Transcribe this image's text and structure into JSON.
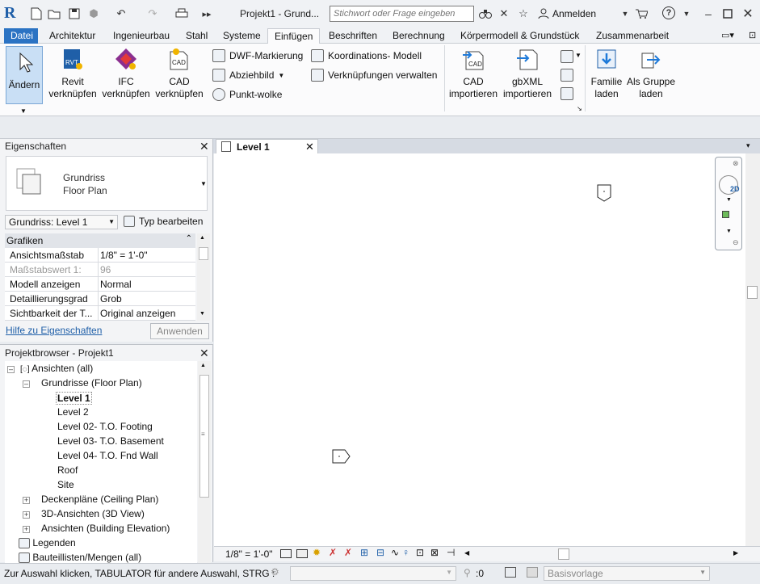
{
  "window": {
    "title": "Projekt1 - Grund...",
    "search_placeholder": "Stichwort oder Frage eingeben",
    "signin_label": "Anmelden",
    "help_label": "?"
  },
  "menu_tabs": {
    "file": "Datei",
    "architektur": "Architektur",
    "ingenieurbau": "Ingenieurbau",
    "stahl": "Stahl",
    "systeme": "Systeme",
    "einfuegen": "Einfügen",
    "beschriften": "Beschriften",
    "berechnung": "Berechnung",
    "koerpermodell": "Körpermodell & Grundstück",
    "zusammenarbeit": "Zusammenarbeit"
  },
  "ribbon": {
    "modify": "Ändern",
    "revit_link_1": "Revit",
    "revit_link_2": "verknüpfen",
    "ifc_link_1": "IFC",
    "ifc_link_2": "verknüpfen",
    "cad_link_1": "CAD",
    "cad_link_2": "verknüpfen",
    "dwf_markup": "DWF-Markierung",
    "decal": "Abziehbild",
    "point_cloud": "Punkt-wolke",
    "coord_model": "Koordinations- Modell",
    "manage_links": "Verknüpfungen verwalten",
    "cad_import_1": "CAD",
    "cad_import_2": "importieren",
    "gbxml_1": "gbXML",
    "gbxml_2": "importieren",
    "family_1": "Familie",
    "family_2": "laden",
    "group_1": "Als Gruppe",
    "group_2": "laden",
    "revit_icon_text": "RVT",
    "cad_icon_text": "CAD"
  },
  "properties": {
    "title": "Eigenschaften",
    "type_name_1": "Grundriss",
    "type_name_2": "Floor Plan",
    "instance_select": "Grundriss: Level 1",
    "edit_type": "Typ bearbeiten",
    "group_graphics": "Grafiken",
    "rows": [
      {
        "key": "Ansichtsmaßstab",
        "value": "1/8\" = 1'-0\""
      },
      {
        "key": "Maßstabswert 1:",
        "value": "96"
      },
      {
        "key": "Modell anzeigen",
        "value": "Normal"
      },
      {
        "key": "Detaillierungsgrad",
        "value": "Grob"
      },
      {
        "key": "Sichtbarkeit der T...",
        "value": "Original anzeigen"
      }
    ],
    "help_link": "Hilfe zu Eigenschaften",
    "apply_button": "Anwenden"
  },
  "project_browser": {
    "title": "Projektbrowser - Projekt1",
    "items": [
      {
        "label": "Ansichten (all)"
      },
      {
        "label": "Grundrisse (Floor Plan)"
      },
      {
        "label": "Level 1"
      },
      {
        "label": "Level 2"
      },
      {
        "label": "Level 02- T.O. Footing"
      },
      {
        "label": "Level 03- T.O. Basement"
      },
      {
        "label": "Level 04- T.O. Fnd Wall"
      },
      {
        "label": "Roof"
      },
      {
        "label": "Site"
      },
      {
        "label": "Deckenpläne (Ceiling Plan)"
      },
      {
        "label": "3D-Ansichten (3D View)"
      },
      {
        "label": "Ansichten (Building Elevation)"
      },
      {
        "label": "Legenden"
      },
      {
        "label": "Bauteillisten/Mengen (all)"
      }
    ]
  },
  "view_tab": {
    "label": "Level 1"
  },
  "view_controls": {
    "scale": "1/8\" = 1'-0\""
  },
  "status_bar": {
    "message": "Zur Auswahl klicken, TABULATOR für andere Auswahl, STRG :",
    "selection_count": ":0",
    "template": "Basisvorlage"
  },
  "colors": {
    "file_tab": "#2b73c3",
    "accent_blue": "#1f5fa8"
  }
}
